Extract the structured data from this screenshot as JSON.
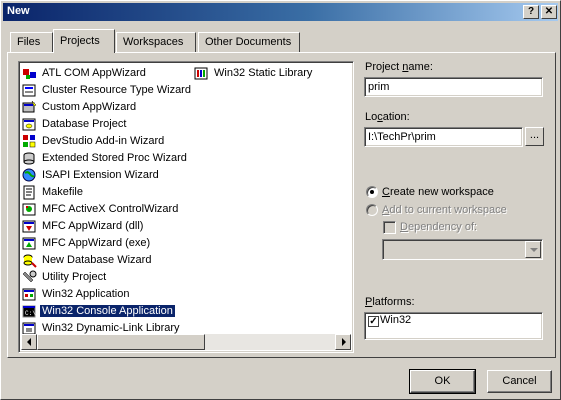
{
  "window": {
    "title": "New",
    "help_glyph": "?",
    "close_glyph": "✕"
  },
  "tabs": [
    {
      "label": "Files"
    },
    {
      "label": "Projects",
      "active": true
    },
    {
      "label": "Workspaces"
    },
    {
      "label": "Other Documents"
    }
  ],
  "project_list": {
    "column1": [
      {
        "label": "ATL COM AppWizard",
        "icon": "atl-com-icon"
      },
      {
        "label": "Cluster Resource Type Wizard",
        "icon": "cluster-wizard-icon"
      },
      {
        "label": "Custom AppWizard",
        "icon": "custom-appwizard-icon"
      },
      {
        "label": "Database Project",
        "icon": "database-project-icon"
      },
      {
        "label": "DevStudio Add-in Wizard",
        "icon": "addin-wizard-icon"
      },
      {
        "label": "Extended Stored Proc Wizard",
        "icon": "stored-proc-icon"
      },
      {
        "label": "ISAPI Extension Wizard",
        "icon": "isapi-globe-icon"
      },
      {
        "label": "Makefile",
        "icon": "makefile-icon"
      },
      {
        "label": "MFC ActiveX ControlWizard",
        "icon": "activex-icon"
      },
      {
        "label": "MFC AppWizard (dll)",
        "icon": "mfc-dll-icon"
      },
      {
        "label": "MFC AppWizard (exe)",
        "icon": "mfc-exe-icon"
      },
      {
        "label": "New Database Wizard",
        "icon": "new-database-icon"
      },
      {
        "label": "Utility Project",
        "icon": "utility-project-icon"
      },
      {
        "label": "Win32 Application",
        "icon": "win32-app-icon"
      },
      {
        "label": "Win32 Console Application",
        "icon": "console-app-icon",
        "selected": true
      },
      {
        "label": "Win32 Dynamic-Link Library",
        "icon": "win32-dll-icon"
      }
    ],
    "column2": [
      {
        "label": "Win32 Static Library",
        "icon": "static-library-icon"
      }
    ]
  },
  "project_name": {
    "label_pre": "Project ",
    "label_accel": "n",
    "label_post": "ame:",
    "value": "prim"
  },
  "location": {
    "label_pre": "Lo",
    "label_accel": "c",
    "label_post": "ation:",
    "value": "I:\\TechPr\\prim",
    "browse_label": "..."
  },
  "workspace": {
    "create_accel": "C",
    "create_rest": "reate new workspace",
    "add_accel": "A",
    "add_rest": "dd to current workspace",
    "dependency_accel": "D",
    "dependency_rest": "ependency of:"
  },
  "platforms": {
    "label_accel": "P",
    "label_rest": "latforms:",
    "items": [
      {
        "label": "Win32",
        "checked": true,
        "check_glyph": "✓"
      }
    ]
  },
  "buttons": {
    "ok": "OK",
    "cancel": "Cancel"
  }
}
